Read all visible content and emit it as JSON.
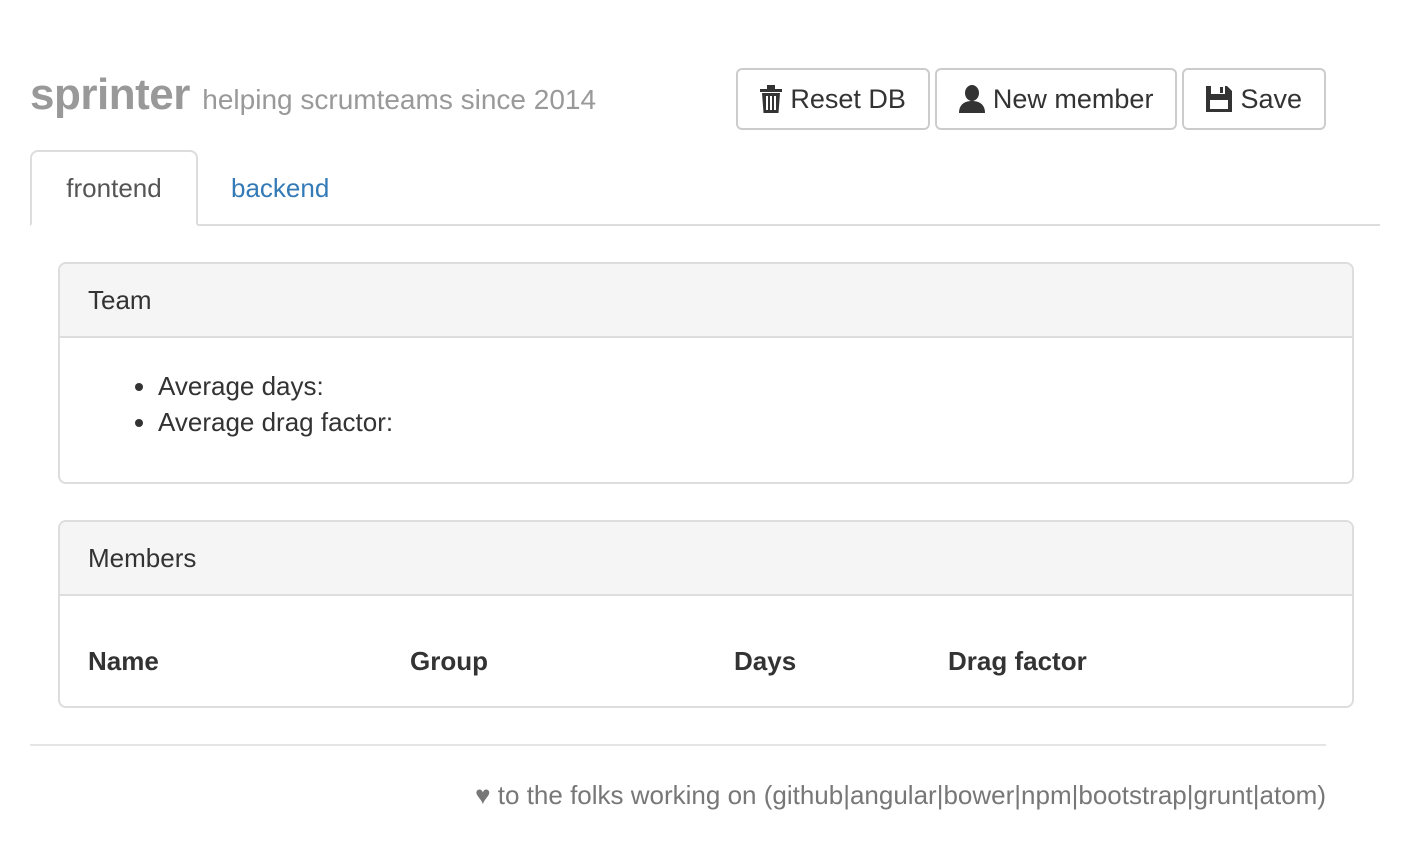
{
  "header": {
    "title": "sprinter",
    "tagline": "helping scrumteams since 2014"
  },
  "toolbar": {
    "reset_label": "Reset DB",
    "new_member_label": "New member",
    "save_label": "Save",
    "reset_icon": "trash-icon",
    "new_member_icon": "user-icon",
    "save_icon": "floppy-disk-icon"
  },
  "tabs": [
    {
      "label": "frontend",
      "active": true
    },
    {
      "label": "backend",
      "active": false
    }
  ],
  "team_panel": {
    "heading": "Team",
    "stats": [
      "Average days:",
      "Average drag factor:"
    ]
  },
  "members_panel": {
    "heading": "Members",
    "columns": [
      "Name",
      "Group",
      "Days",
      "Drag factor"
    ]
  },
  "footer": {
    "text": "♥ to the folks working on (github|angular|bower|npm|bootstrap|grunt|atom)"
  },
  "colors": {
    "link": "#337ab7",
    "muted": "#999999",
    "border": "#dddddd",
    "panel_heading_bg": "#f5f5f5"
  }
}
